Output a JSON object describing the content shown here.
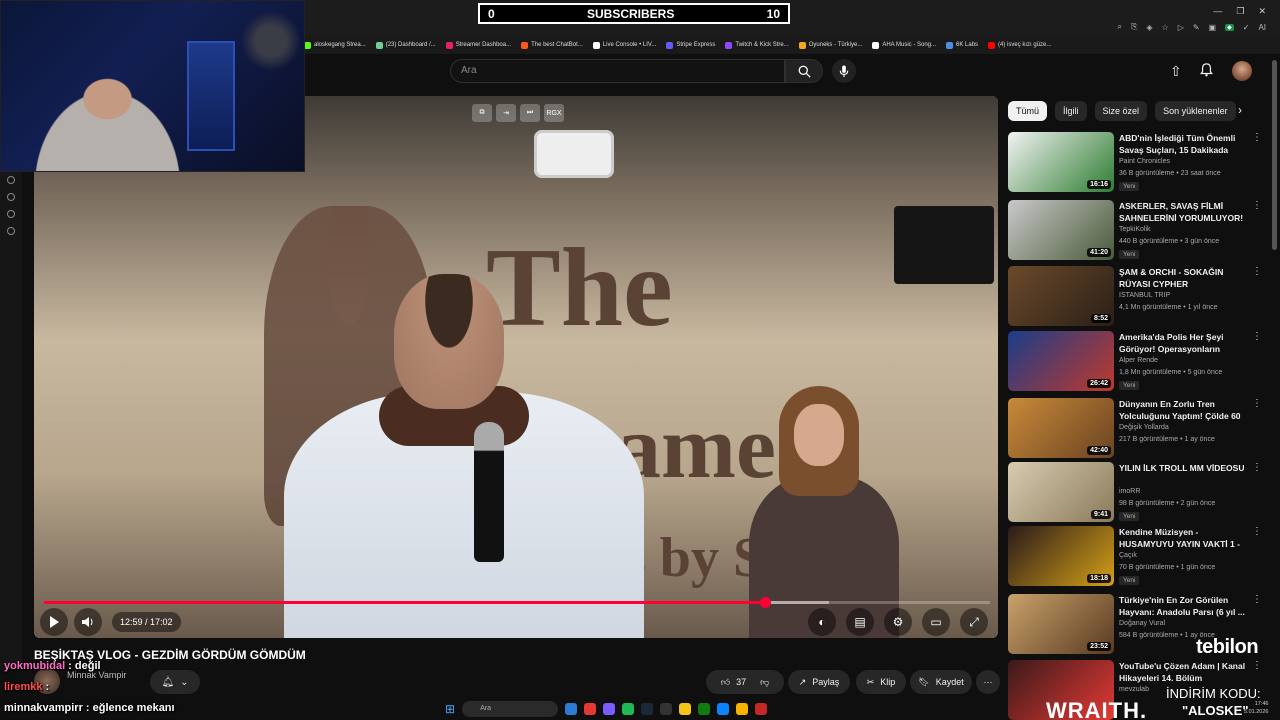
{
  "overlay": {
    "subscribers_left": "0",
    "subscribers_label": "SUBSCRIBERS",
    "subscribers_right": "10"
  },
  "bookmarks": [
    {
      "label": "aloskegang Strea...",
      "color": "#53fc18"
    },
    {
      "label": "(23) Dashboard /...",
      "color": "#6fcf97"
    },
    {
      "label": "Streamer Dashboa...",
      "color": "#e91e63"
    },
    {
      "label": "The best ChatBot...",
      "color": "#ff5722"
    },
    {
      "label": "Live Console • LIV...",
      "color": "#ffffff"
    },
    {
      "label": "Stripe Express",
      "color": "#635bff"
    },
    {
      "label": "Twitch & Kick Stre...",
      "color": "#9147ff"
    },
    {
      "label": "Oyuneks - Türkiye...",
      "color": "#f5a623"
    },
    {
      "label": "AHA Music - Song...",
      "color": "#ffffff"
    },
    {
      "label": "6K Labs",
      "color": "#4a90e2"
    },
    {
      "label": "(4) isveç kızı güze...",
      "color": "#ff0000"
    }
  ],
  "browser": {
    "ext_badge": "AI"
  },
  "youtube": {
    "search_placeholder": "Ara"
  },
  "player": {
    "wall_text_1": "The",
    "wall_text_2": "ame",
    "wall_text_3": "s by So",
    "overlay_tag": "RGX",
    "current_time": "12:59",
    "duration": "17:02",
    "time_display": "12:59 / 17:02",
    "played_fraction": 0.7625,
    "buffered_fraction": 0.83
  },
  "video": {
    "title": "BEŞİKTAŞ VLOG - GEZDİM GÖRDÜM GÖMDÜM",
    "channel": "Minnak Vampir",
    "likes": "37",
    "share_label": "Paylaş",
    "clip_label": "Klip",
    "save_label": "Kaydet"
  },
  "chat": [
    {
      "user": "yokmubidal",
      "message": " : değil",
      "color": "#ff6ec7"
    },
    {
      "user": "liremkk",
      "message": " :",
      "color": "#ff4d4d"
    },
    {
      "user": "minnakvampirr",
      "message": " : eğlence mekanı",
      "color": "#ffffff"
    }
  ],
  "chips": [
    "Tümü",
    "İlgili",
    "Size özel",
    "Son yüklenenler"
  ],
  "recommendations": [
    {
      "title": "ABD'nin İşlediği Tüm Önemli Savaş Suçları, 15 Dakikada",
      "channel": "Paint Chronicles",
      "meta": "36 B görüntüleme • 23 saat önce",
      "duration": "16:16",
      "badge": "Yeni",
      "thumb_a": "#f2f2f2",
      "thumb_b": "#2e7d32"
    },
    {
      "title": "ASKERLER, SAVAŞ FİLMİ SAHNELERİNİ YORUMLUYOR!",
      "channel": "TepkiKolik",
      "meta": "440 B görüntüleme • 3 gün önce",
      "duration": "41:20",
      "badge": "Yeni",
      "thumb_a": "#c9c9c9",
      "thumb_b": "#4a5a3a"
    },
    {
      "title": "ŞAM & ORCHI - SOKAĞIN RÜYASI CYPHER",
      "channel": "ISTANBUL TRIP",
      "meta": "4,1 Mn görüntüleme • 1 yıl önce",
      "duration": "8:52",
      "badge": "",
      "thumb_a": "#6b4a2a",
      "thumb_b": "#2a1f17"
    },
    {
      "title": "Amerika'da Polis Her Şeyi Görüyor! Operasyonların Perde...",
      "channel": "Alper Rende",
      "meta": "1,8 Mn görüntüleme • 5 gün önce",
      "duration": "26:42",
      "badge": "Yeni",
      "thumb_a": "#1a3d8a",
      "thumb_b": "#c0392b"
    },
    {
      "title": "Dünyanın En Zorlu Tren Yolculuğunu Yaptım! Çölde 60 ...",
      "channel": "Değişik Yollarda",
      "meta": "217 B görüntüleme • 1 ay önce",
      "duration": "42:40",
      "badge": "",
      "thumb_a": "#c98a3a",
      "thumb_b": "#6a4320"
    },
    {
      "title": "YILIN İLK TROLL MM VİDEOSU",
      "channel": "imoRR",
      "meta": "98 B görüntüleme • 2 gün önce",
      "duration": "9:41",
      "badge": "Yeni",
      "thumb_a": "#d8cbb0",
      "thumb_b": "#8a7a5a"
    },
    {
      "title": "Kendine Müzisyen - HUSAMYUYU YAYIN VAKTİ 1 - ...",
      "channel": "Çaçık",
      "meta": "70 B görüntüleme • 1 gün önce",
      "duration": "18:18",
      "badge": "Yeni",
      "thumb_a": "#2a1a1a",
      "thumb_b": "#d4a017"
    },
    {
      "title": "Türkiye'nin En Zor Görülen Hayvanı: Anadolu Parsı (6 yıl ...",
      "channel": "Doğanay Vural",
      "meta": "584 B görüntüleme • 1 ay önce",
      "duration": "23:52",
      "badge": "",
      "thumb_a": "#c8a26a",
      "thumb_b": "#5a3a22"
    },
    {
      "title": "YouTube'u Çözen Adam | Kanal Hikayeleri 14. Bölüm",
      "channel": "mevzulab",
      "meta": "",
      "duration": "",
      "badge": "",
      "thumb_a": "#3a1a1a",
      "thumb_b": "#e53935"
    }
  ],
  "sponsor": {
    "brand": "tebilon",
    "discount_label": "İNDİRİM KODU:",
    "wraith": "WRAITH.",
    "code": "\"ALOSKE\""
  },
  "taskbar": {
    "search_label": "Ara"
  },
  "clock": {
    "time": "17:46",
    "date": "5.01.2026"
  }
}
